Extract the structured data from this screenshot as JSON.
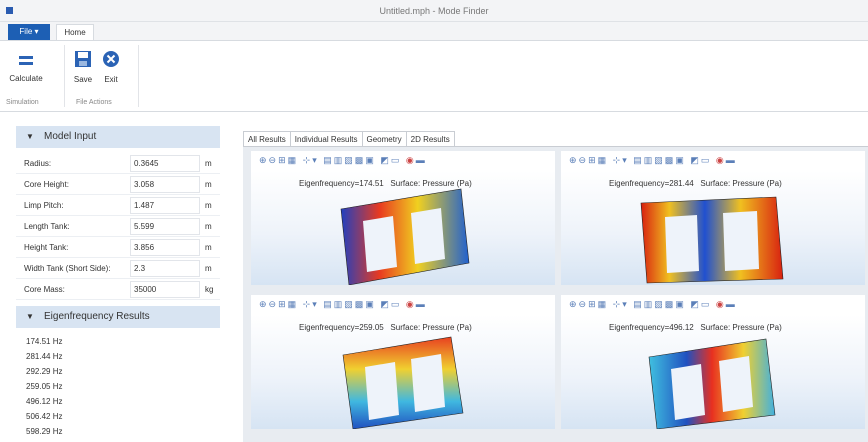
{
  "window": {
    "title": "Untitled.mph - Mode Finder"
  },
  "ribbon": {
    "file_label": "File ▾",
    "home_tab": "Home",
    "calculate": "Calculate",
    "save": "Save",
    "exit": "Exit",
    "group_simulation": "Simulation",
    "group_file_actions": "File Actions"
  },
  "model_input": {
    "title": "Model Input",
    "rows": [
      {
        "label": "Radius:",
        "value": "0.3645",
        "unit": "m"
      },
      {
        "label": "Core Height:",
        "value": "3.058",
        "unit": "m"
      },
      {
        "label": "Limp Pitch:",
        "value": "1.487",
        "unit": "m"
      },
      {
        "label": "Length Tank:",
        "value": "5.599",
        "unit": "m"
      },
      {
        "label": "Height Tank:",
        "value": "3.856",
        "unit": "m"
      },
      {
        "label": "Width Tank (Short Side):",
        "value": "2.3",
        "unit": "m"
      },
      {
        "label": "Core Mass:",
        "value": "35000",
        "unit": "kg"
      }
    ]
  },
  "eigen_results": {
    "title": "Eigenfrequency Results",
    "values": [
      "174.51 Hz",
      "281.44 Hz",
      "292.29 Hz",
      "259.05 Hz",
      "496.12 Hz",
      "506.42 Hz",
      "598.29 Hz"
    ]
  },
  "tabs": [
    "All Results",
    "Individual Results",
    "Geometry",
    "2D Results"
  ],
  "plots": [
    {
      "eigenfrequency": "Eigenfrequency=174.51",
      "surface": "Surface: Pressure (Pa)"
    },
    {
      "eigenfrequency": "Eigenfrequency=281.44",
      "surface": "Surface: Pressure (Pa)"
    },
    {
      "eigenfrequency": "Eigenfrequency=259.05",
      "surface": "Surface: Pressure (Pa)"
    },
    {
      "eigenfrequency": "Eigenfrequency=496.12",
      "surface": "Surface: Pressure (Pa)"
    }
  ],
  "colors": {
    "accent": "#1d5fb4",
    "section_header": "#d8e4f2",
    "toolbar_icons": "#5b7fb8"
  }
}
